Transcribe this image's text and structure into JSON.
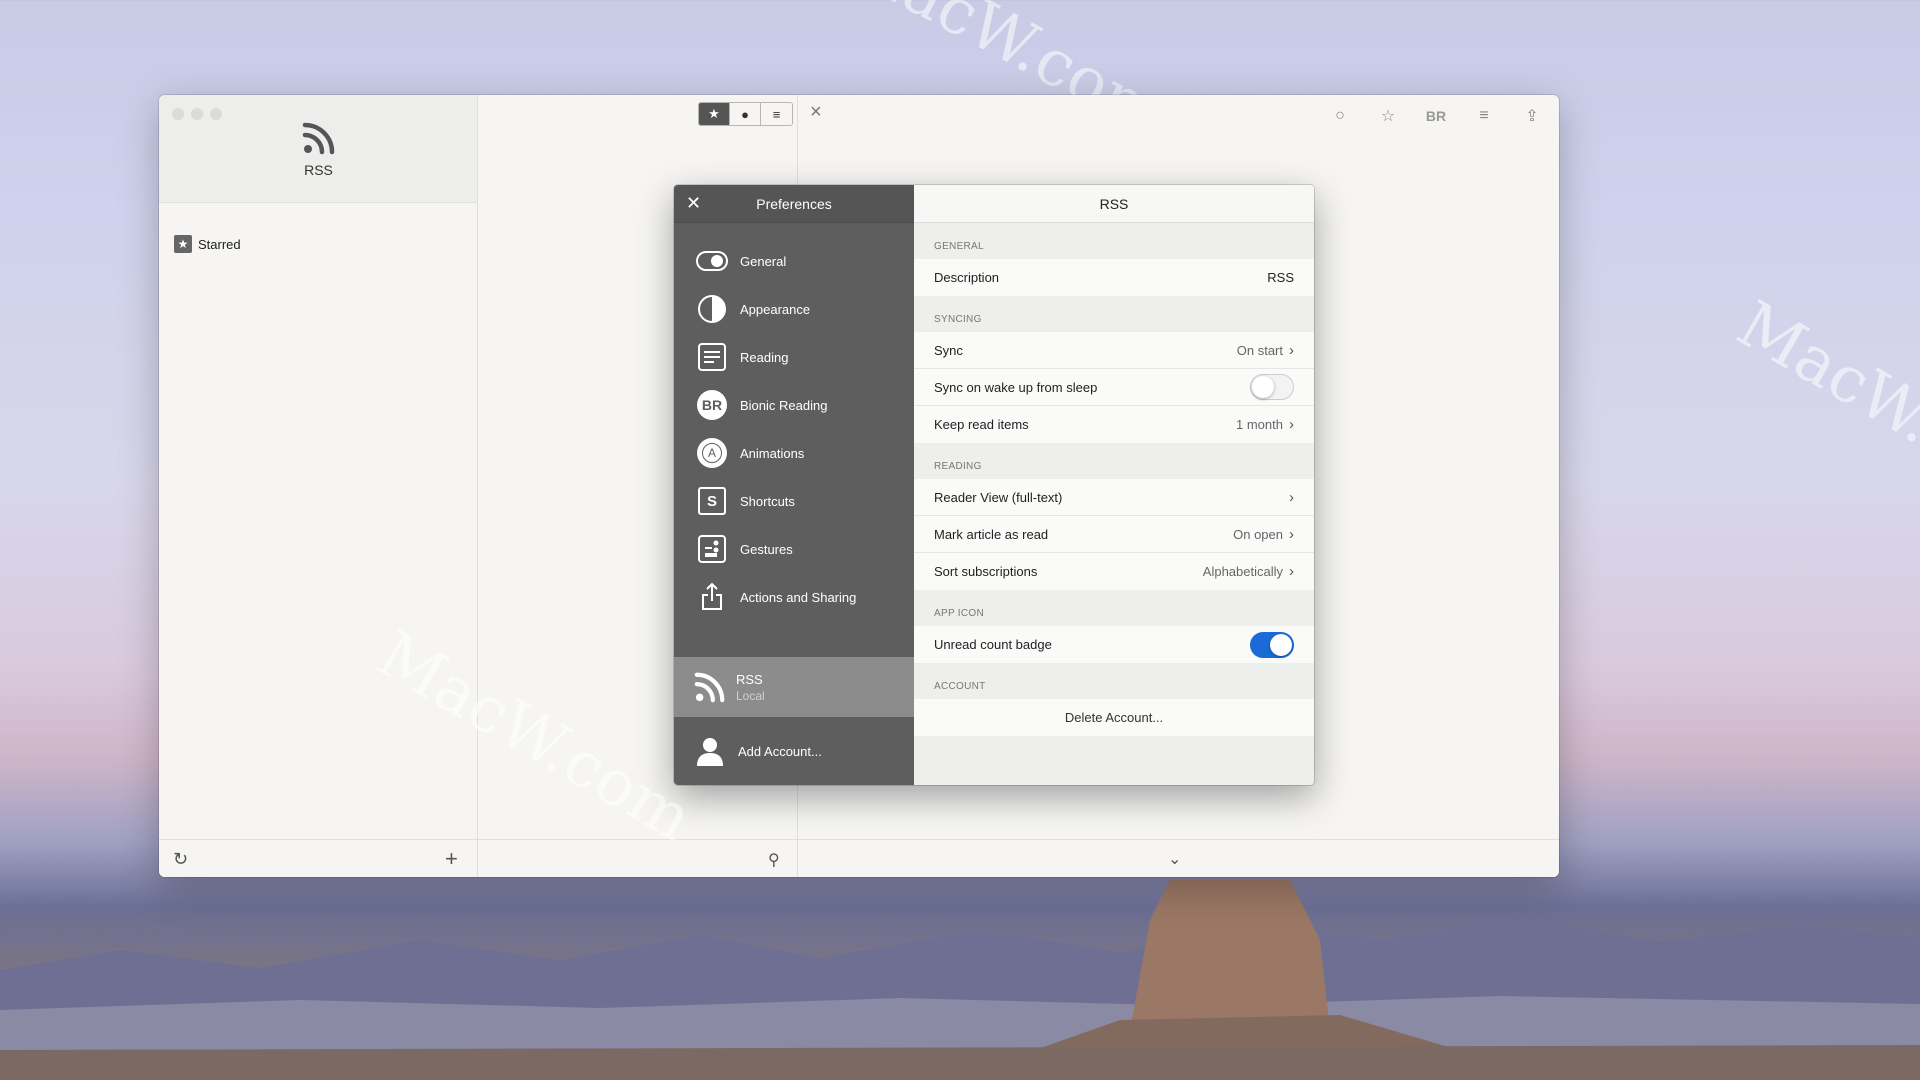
{
  "app": {
    "title": "RSS",
    "sidebar": {
      "starred_label": "Starred"
    },
    "list_filters": {
      "starred_icon": "star-icon",
      "unread_icon": "dot-icon",
      "all_icon": "lines-icon"
    },
    "article_tools": [
      "circle-icon",
      "star-outline-icon",
      "BR",
      "text-lines-icon",
      "share-icon"
    ]
  },
  "preferences": {
    "title": "Preferences",
    "nav": [
      {
        "label": "General",
        "icon": "toggle-icon"
      },
      {
        "label": "Appearance",
        "icon": "contrast-icon"
      },
      {
        "label": "Reading",
        "icon": "reading-icon"
      },
      {
        "label": "Bionic Reading",
        "icon": "BR"
      },
      {
        "label": "Animations",
        "icon": "A"
      },
      {
        "label": "Shortcuts",
        "icon": "S"
      },
      {
        "label": "Gestures",
        "icon": "gestures-icon"
      },
      {
        "label": "Actions and Sharing",
        "icon": "share-icon"
      }
    ],
    "account": {
      "name": "RSS",
      "type": "Local"
    },
    "add_account": "Add Account...",
    "detail": {
      "title": "RSS",
      "sections": {
        "general": {
          "label": "General",
          "description_label": "Description",
          "description_value": "RSS"
        },
        "syncing": {
          "label": "Syncing",
          "sync_label": "Sync",
          "sync_value": "On start",
          "wake_label": "Sync on wake up from sleep",
          "wake_on": false,
          "keep_label": "Keep read items",
          "keep_value": "1 month"
        },
        "reading": {
          "label": "Reading",
          "reader_label": "Reader View (full-text)",
          "mark_label": "Mark article as read",
          "mark_value": "On open",
          "sort_label": "Sort subscriptions",
          "sort_value": "Alphabetically"
        },
        "app_icon": {
          "label": "App Icon",
          "badge_label": "Unread count badge",
          "badge_on": true
        },
        "account": {
          "label": "Account",
          "delete_label": "Delete Account..."
        }
      }
    }
  },
  "colors": {
    "toggle_on": "#1a6bd8",
    "prefs_sidebar": "#5e5e5e",
    "account_selected": "#8c8c8c"
  },
  "watermarks": [
    "MacW.com",
    "MacW.com",
    "MacW.com"
  ]
}
